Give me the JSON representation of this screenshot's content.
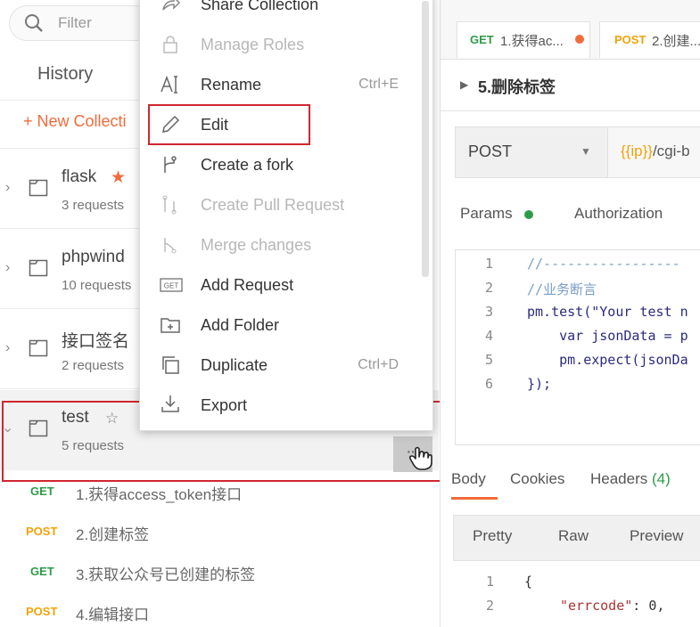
{
  "sidebar": {
    "search_placeholder": "Filter",
    "history_label": "History",
    "new_collection": "+ New Collecti",
    "collections": [
      {
        "name": "flask",
        "count": "3 requests",
        "starred": true
      },
      {
        "name": "phpwind",
        "count": "10 requests"
      },
      {
        "name": "接口签名",
        "count": "2 requests"
      },
      {
        "name": "test",
        "count": "5 requests",
        "starred": false
      }
    ],
    "requests": [
      {
        "method": "GET",
        "name": "1.获得access_token接口"
      },
      {
        "method": "POST",
        "name": "2.创建标签"
      },
      {
        "method": "GET",
        "name": "3.获取公众号已创建的标签"
      },
      {
        "method": "POST",
        "name": "4.编辑接口"
      }
    ]
  },
  "menu": {
    "items": [
      {
        "label": "Share Collection",
        "shortcut": "",
        "disabled": false,
        "icon": "share-icon"
      },
      {
        "label": "Manage Roles",
        "shortcut": "",
        "disabled": true,
        "icon": "lock-icon"
      },
      {
        "label": "Rename",
        "shortcut": "Ctrl+E",
        "disabled": false,
        "icon": "rename-icon"
      },
      {
        "label": "Edit",
        "shortcut": "",
        "disabled": false,
        "icon": "pencil-icon"
      },
      {
        "label": "Create a fork",
        "shortcut": "",
        "disabled": false,
        "icon": "fork-icon"
      },
      {
        "label": "Create Pull Request",
        "shortcut": "",
        "disabled": true,
        "icon": "pull-request-icon"
      },
      {
        "label": "Merge changes",
        "shortcut": "",
        "disabled": true,
        "icon": "merge-icon"
      },
      {
        "label": "Add Request",
        "shortcut": "",
        "disabled": false,
        "icon": "get-request-icon"
      },
      {
        "label": "Add Folder",
        "shortcut": "",
        "disabled": false,
        "icon": "folder-add-icon"
      },
      {
        "label": "Duplicate",
        "shortcut": "Ctrl+D",
        "disabled": false,
        "icon": "duplicate-icon"
      },
      {
        "label": "Export",
        "shortcut": "",
        "disabled": false,
        "icon": "export-icon"
      }
    ]
  },
  "right": {
    "tabs": [
      {
        "method": "GET",
        "label": "1.获得ac..."
      },
      {
        "method": "POST",
        "label": "2.创建..."
      }
    ],
    "request_title": "5.删除标签",
    "method": "POST",
    "url_var": "{{ip}}",
    "url_rest": "/cgi-b",
    "subtabs": {
      "params": "Params",
      "authorization": "Authorization"
    },
    "code_lines": [
      {
        "n": "1",
        "text": "//-----------------"
      },
      {
        "n": "2",
        "text": "//业务断言"
      },
      {
        "n": "3",
        "text": "pm.test(\"Your test n"
      },
      {
        "n": "4",
        "text": "    var jsonData = p"
      },
      {
        "n": "5",
        "text": "    pm.expect(jsonDa"
      },
      {
        "n": "6",
        "text": "});"
      }
    ],
    "response_tabs": {
      "body": "Body",
      "cookies": "Cookies",
      "headers": "Headers",
      "headers_count": "(4)"
    },
    "response_options": {
      "pretty": "Pretty",
      "raw": "Raw",
      "preview": "Preview"
    },
    "response_lines": [
      {
        "n": "1",
        "text": "{"
      },
      {
        "n": "2",
        "key": "\"errcode\"",
        "value": ": 0,"
      }
    ]
  },
  "colors": {
    "accent": "#f26b3a",
    "get": "#2e9b48",
    "post": "#f0a30a",
    "highlight": "#d0262f"
  }
}
